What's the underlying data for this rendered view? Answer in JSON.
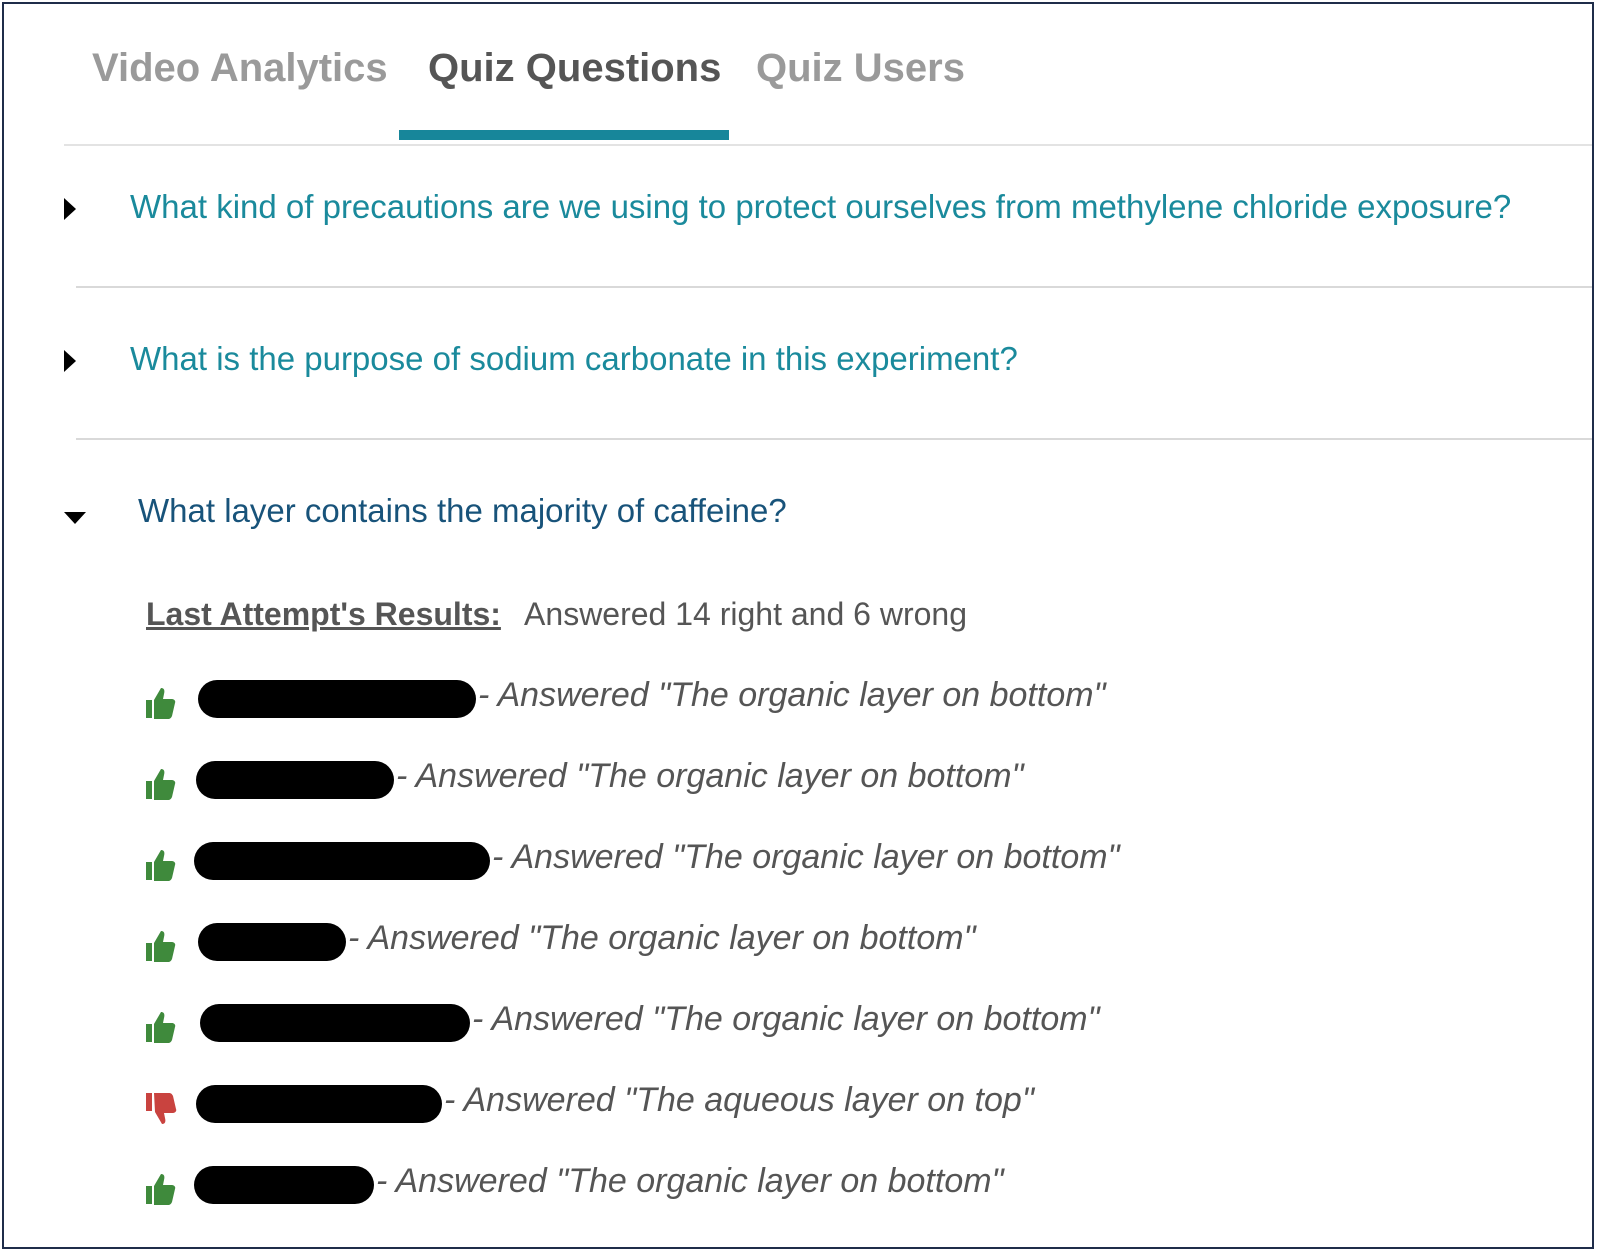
{
  "tabs": [
    {
      "label": "Video Analytics",
      "active": false
    },
    {
      "label": "Quiz Questions",
      "active": true
    },
    {
      "label": "Quiz Users",
      "active": false
    }
  ],
  "accent_color": "#17869a",
  "questions": [
    {
      "text": "What kind of precautions are we using to protect ourselves from methylene chloride exposure?",
      "expanded": false
    },
    {
      "text": "What is the purpose of sodium carbonate in this experiment?",
      "expanded": false
    },
    {
      "text": "What layer contains the majority of caffeine?",
      "expanded": true
    }
  ],
  "results": {
    "label": "Last Attempt's Results:",
    "summary": "Answered 14 right and 6 wrong",
    "answers": [
      {
        "correct": true,
        "text": "- Answered \"The organic layer on bottom\""
      },
      {
        "correct": true,
        "text": "- Answered \"The organic layer on bottom\""
      },
      {
        "correct": true,
        "text": "- Answered \"The organic layer on bottom\""
      },
      {
        "correct": true,
        "text": "- Answered \"The organic layer on bottom\""
      },
      {
        "correct": true,
        "text": "- Answered \"The organic layer on bottom\""
      },
      {
        "correct": false,
        "text": "- Answered \"The aqueous layer on top\""
      },
      {
        "correct": true,
        "text": "- Answered \"The organic layer on bottom\""
      }
    ]
  },
  "icons": {
    "correct": "thumbs-up-icon",
    "wrong": "thumbs-down-icon",
    "correct_color": "#3f8a3c",
    "wrong_color": "#c9433f"
  }
}
